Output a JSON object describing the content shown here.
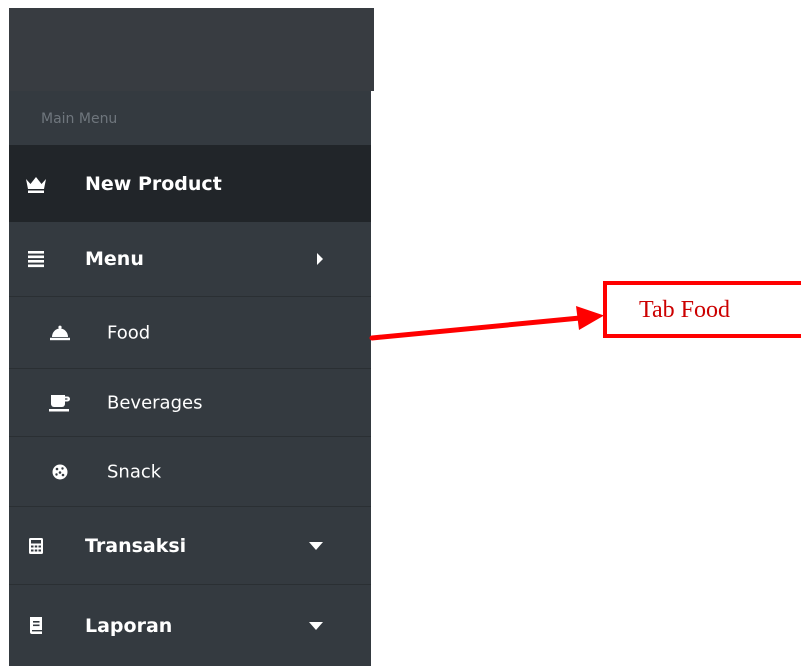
{
  "sidebar": {
    "section_label": "Main Menu",
    "items": [
      {
        "label": "New Product",
        "icon": "crown-icon"
      },
      {
        "label": "Menu",
        "icon": "list-icon",
        "chevron": "caret-right-icon"
      },
      {
        "label": "Food",
        "icon": "food-cloche-icon"
      },
      {
        "label": "Beverages",
        "icon": "coffee-cup-icon"
      },
      {
        "label": "Snack",
        "icon": "cookie-icon"
      },
      {
        "label": "Transaksi",
        "icon": "calculator-icon",
        "chevron": "caret-down-icon"
      },
      {
        "label": "Laporan",
        "icon": "book-icon",
        "chevron": "caret-down-icon"
      }
    ]
  },
  "annotation": {
    "label": "Tab Food",
    "color": "#ff0000"
  },
  "colors": {
    "sidebar_bg": "#343a40",
    "active_bg": "#212529",
    "muted_text": "#6f767d"
  }
}
